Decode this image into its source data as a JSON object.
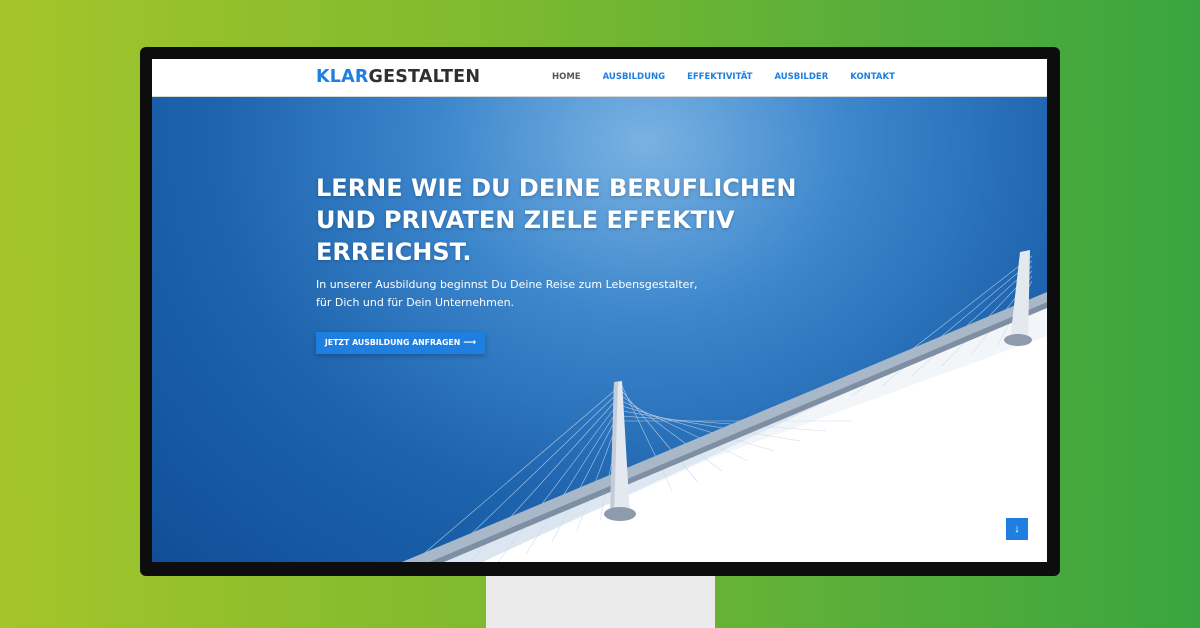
{
  "brand": {
    "part1": "KLAR",
    "part2": "GESTALTEN",
    "accent_color": "#1f7fe0",
    "dark_color": "#2f2f2f"
  },
  "nav": {
    "items": [
      {
        "label": "HOME",
        "active": true
      },
      {
        "label": "AUSBILDUNG",
        "active": false
      },
      {
        "label": "EFFEKTIVITÄT",
        "active": false
      },
      {
        "label": "AUSBILDER",
        "active": false
      },
      {
        "label": "KONTAKT",
        "active": false
      }
    ]
  },
  "hero": {
    "title_line1": "LERNE WIE DU DEINE BERUFLICHEN",
    "title_line2": "UND PRIVATEN ZIELE EFFEKTIV",
    "title_line3": "ERREICHST.",
    "subtitle_line1": "In unserer Ausbildung beginnst Du Deine Reise zum Lebensgestalter,",
    "subtitle_line2": "für Dich und für Dein Unternehmen.",
    "cta_label": "JETZT AUSBILDUNG ANFRAGEN",
    "cta_icon": "arrow-right-icon",
    "cta_arrow": "⟶",
    "scroll_icon": "arrow-down-icon",
    "scroll_glyph": "↓"
  },
  "colors": {
    "background_gradient_start": "#a4c52a",
    "background_gradient_end": "#3aa53f",
    "hero_blue": "#1d63ad"
  }
}
